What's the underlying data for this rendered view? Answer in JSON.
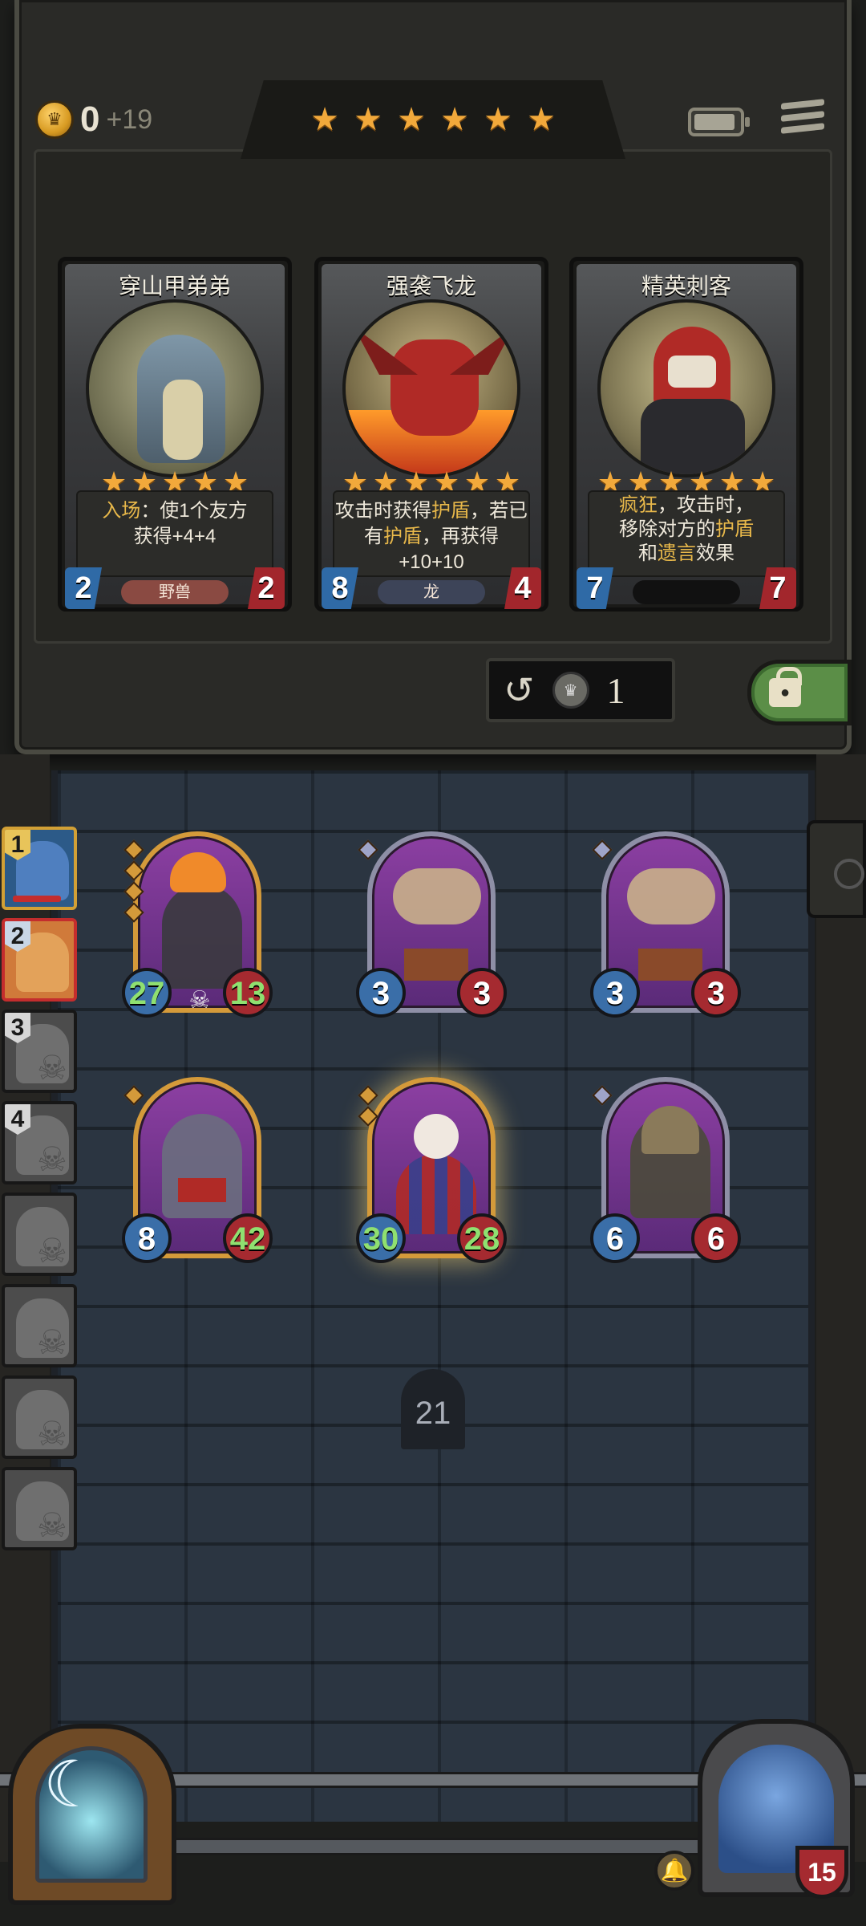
{
  "header": {
    "gold": "0",
    "gold_income": "+19",
    "tavern_stars": 6,
    "battery_icon": "battery-icon",
    "menu_icon": "menu-icon"
  },
  "shop": {
    "cards": [
      {
        "name": "穿山甲弟弟",
        "stars": 5,
        "desc_kw": "入场",
        "desc_line1": "：使1个友方",
        "desc_line2": "获得+4+4",
        "desc_line3": "",
        "attack": "2",
        "health": "2",
        "tribe": "野兽"
      },
      {
        "name": "强袭飞龙",
        "stars": 6,
        "desc_line1": "攻击时获得护盾，若已",
        "desc_line2": "有护盾，再获得+10+10",
        "desc_line3": "",
        "attack": "8",
        "health": "4",
        "tribe": "龙"
      },
      {
        "name": "精英刺客",
        "stars": 6,
        "desc_line1": "疯狂，攻击时，",
        "desc_line2": "移除对方的护盾",
        "desc_line3": "和遗言效果",
        "attack": "7",
        "health": "7",
        "tribe": ""
      }
    ],
    "refresh_cost": "1",
    "refresh_icon": "refresh-icon",
    "lock_icon": "lock-icon"
  },
  "opponents": [
    {
      "rank": "1",
      "state": "active"
    },
    {
      "rank": "2",
      "state": "target"
    },
    {
      "rank": "3",
      "state": "dead"
    },
    {
      "rank": "4",
      "state": "dead"
    },
    {
      "rank": "",
      "state": "dead"
    },
    {
      "rank": "",
      "state": "dead"
    },
    {
      "rank": "",
      "state": "dead"
    },
    {
      "rank": "",
      "state": "dead"
    }
  ],
  "board": {
    "minions": [
      {
        "attack": "27",
        "health": "13"
      },
      {
        "attack": "3",
        "health": "3"
      },
      {
        "attack": "3",
        "health": "3"
      },
      {
        "attack": "8",
        "health": "42"
      },
      {
        "attack": "30",
        "health": "28"
      },
      {
        "attack": "6",
        "health": "6"
      }
    ],
    "countdown": "21"
  },
  "player": {
    "health": "15"
  },
  "colors": {
    "gold_star": "#f2a93b",
    "attack_blue": "#3a6ea8",
    "health_red": "#a52a30",
    "keyword_gold": "#e8b84a",
    "lock_green": "#5b8e47"
  }
}
